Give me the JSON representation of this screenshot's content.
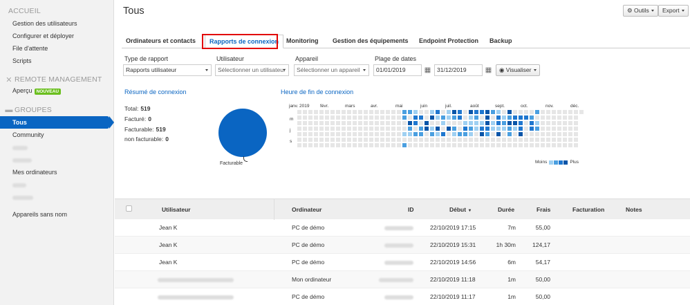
{
  "sidebar": {
    "accueil": "ACCUEIL",
    "accueil_items": [
      "Gestion des utilisateurs",
      "Configurer et déployer",
      "File d'attente",
      "Scripts"
    ],
    "remote": "REMOTE MANAGEMENT",
    "apercu": "Aperçu",
    "new_badge": "NOUVEAU",
    "groupes": "GROUPES",
    "tous": "Tous",
    "community": "Community",
    "mes_ordinateurs": "Mes ordinateurs",
    "sans_nom": "Appareils sans nom"
  },
  "header": {
    "title": "Tous",
    "outils": "Outils",
    "export": "Export"
  },
  "tabs": [
    "Ordinateurs et contacts",
    "Rapports de connexion",
    "Monitoring",
    "Gestion des équipements",
    "Endpoint Protection",
    "Backup"
  ],
  "filters": {
    "type_label": "Type de rapport",
    "type_value": "Rapports utilisateur",
    "user_label": "Utilisateur",
    "user_placeholder": "Sélectionner un utilisateur",
    "device_label": "Appareil",
    "device_placeholder": "Sélectionner un appareil",
    "date_label": "Plage de dates",
    "date_from": "01/01/2019",
    "date_to": "31/12/2019",
    "visualiser": "Visualiser"
  },
  "summary": {
    "title": "Résumé de connexion",
    "total_label": "Total:",
    "total": "519",
    "facture_label": "Facturé:",
    "facture": "0",
    "facturable_label": "Facturable:",
    "facturable": "519",
    "nonfact_label": "non facturable:",
    "nonfact": "0",
    "pie_label": "Facturable"
  },
  "heatmap": {
    "title": "Heure de fin de connexion",
    "months": [
      "janv. 2019",
      "févr.",
      "mars",
      "avr.",
      "mai",
      "juin",
      "juil.",
      "août",
      "sept.",
      "oct.",
      "nov.",
      "déc."
    ],
    "days": [
      "m",
      "j",
      "s"
    ],
    "legend_less": "Moins",
    "legend_more": "Plus",
    "colors": [
      "#e6e6e6",
      "#9fd0f2",
      "#4a9fe0",
      "#1f77cf",
      "#0a55a8"
    ]
  },
  "table": {
    "headers": [
      "Utilisateur",
      "Ordinateur",
      "ID",
      "Début",
      "Durée",
      "Frais",
      "Facturation",
      "Notes"
    ],
    "rows": [
      {
        "user": "Jean K",
        "computer": "PC de démo",
        "start": "22/10/2019 17:15",
        "duration": "7m",
        "fee": "55,00"
      },
      {
        "user": "Jean K",
        "computer": "PC de démo",
        "start": "22/10/2019 15:31",
        "duration": "1h 30m",
        "fee": "124,17"
      },
      {
        "user": "Jean K",
        "computer": "PC de démo",
        "start": "22/10/2019 14:56",
        "duration": "6m",
        "fee": "54,17"
      },
      {
        "user": "",
        "computer": "Mon ordinateur",
        "start": "22/10/2019 11:18",
        "duration": "1m",
        "fee": "50,00"
      },
      {
        "user": "",
        "computer": "PC de démo",
        "start": "22/10/2019 11:17",
        "duration": "1m",
        "fee": "50,00"
      }
    ]
  }
}
